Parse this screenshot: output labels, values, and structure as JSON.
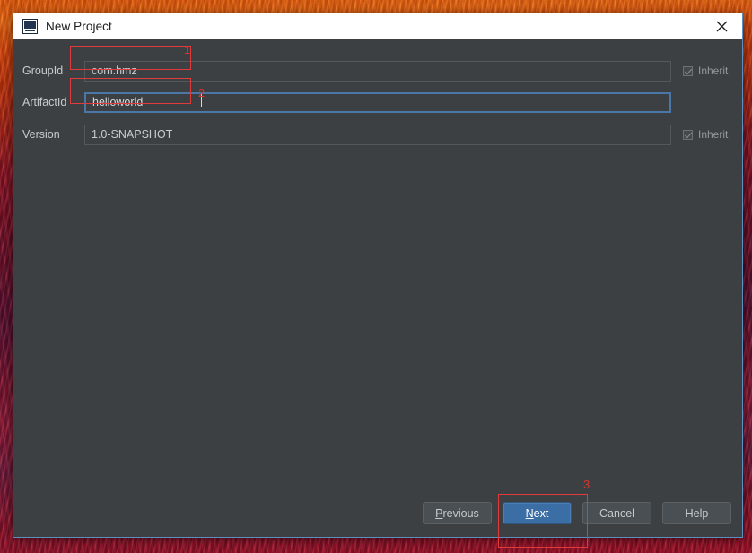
{
  "window": {
    "title": "New Project",
    "app_icon": "intellij-idea-logo",
    "close_icon": "close-icon"
  },
  "form": {
    "rows": [
      {
        "label": "GroupId",
        "value": "com.hmz",
        "focused": false,
        "inherit_label": "Inherit",
        "inherit_checked": true
      },
      {
        "label": "ArtifactId",
        "value": "helloworld",
        "focused": true,
        "inherit_label": "",
        "inherit_checked": false
      },
      {
        "label": "Version",
        "value": "1.0-SNAPSHOT",
        "focused": false,
        "inherit_label": "Inherit",
        "inherit_checked": true
      }
    ]
  },
  "buttons": {
    "previous": {
      "label": "Previous",
      "mnemonic": "P",
      "primary": false
    },
    "next": {
      "label": "Next",
      "mnemonic": "N",
      "primary": true
    },
    "cancel": {
      "label": "Cancel",
      "mnemonic": "",
      "primary": false
    },
    "help": {
      "label": "Help",
      "mnemonic": "",
      "primary": false
    }
  },
  "annotations": {
    "n1": "1",
    "n2": "2",
    "n3": "3",
    "color": "#d8342e"
  },
  "colors": {
    "dialog_background": "#3c4043",
    "titlebar_background": "#ffffff",
    "primary_button": "#3b6ea5",
    "focus_border": "#4b77a8",
    "annotation_red": "#e03a3a"
  }
}
